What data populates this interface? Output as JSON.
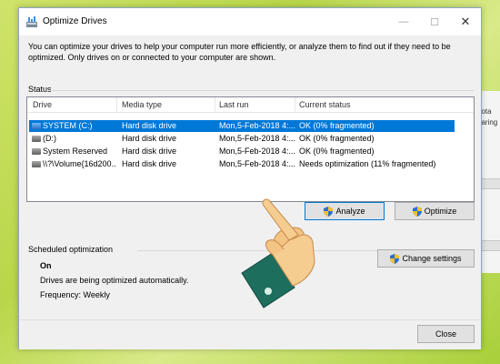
{
  "window": {
    "title": "Optimize Drives",
    "intro": "You can optimize your drives to help your computer run more efficiently, or analyze them to find out if they need to be optimized. Only drives on or connected to your computer are shown."
  },
  "status": {
    "label": "Status",
    "columns": [
      "Drive",
      "Media type",
      "Last run",
      "Current status"
    ],
    "rows": [
      {
        "drive": "SYSTEM (C:)",
        "media": "Hard disk drive",
        "last_run": "Mon,5-Feb-2018 4:...",
        "status": "OK (0% fragmented)"
      },
      {
        "drive": "(D:)",
        "media": "Hard disk drive",
        "last_run": "Mon,5-Feb-2018 4:...",
        "status": "OK (0% fragmented)"
      },
      {
        "drive": "System Reserved",
        "media": "Hard disk drive",
        "last_run": "Mon,5-Feb-2018 4:...",
        "status": "OK (0% fragmented)"
      },
      {
        "drive": "\\\\?\\Volume{16d200...",
        "media": "Hard disk drive",
        "last_run": "Mon,5-Feb-2018 4:...",
        "status": "Needs optimization (11% fragmented)"
      }
    ]
  },
  "buttons": {
    "analyze": "Analyze",
    "optimize": "Optimize",
    "change_settings": "Change settings",
    "close": "Close"
  },
  "scheduled": {
    "label": "Scheduled optimization",
    "state": "On",
    "description": "Drives are being optimized automatically.",
    "frequency": "Frequency: Weekly"
  },
  "background_window": {
    "text_1": "uota",
    "text_2": "haring"
  },
  "colors": {
    "selection": "#0078d7",
    "cuff": "#1e6e5e",
    "hand": "#f3c483"
  }
}
